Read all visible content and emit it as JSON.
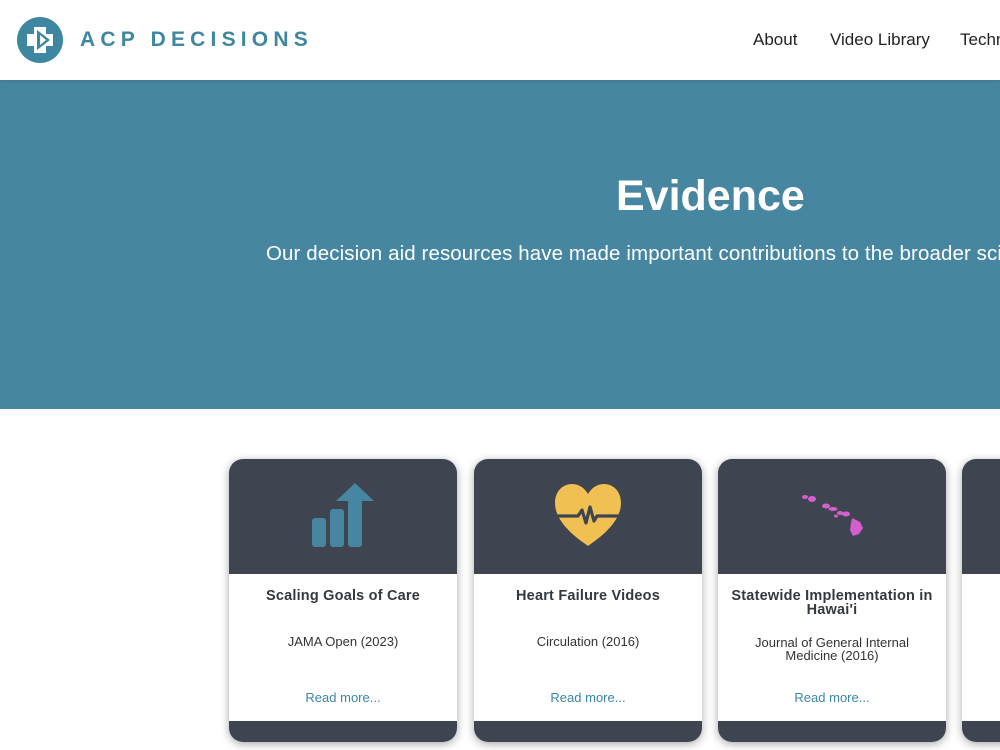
{
  "header": {
    "brand": "ACP DECISIONS",
    "nav": [
      "About",
      "Video Library",
      "Techn"
    ]
  },
  "hero": {
    "title": "Evidence",
    "text": "Our decision aid resources have made important contributions to the broader scie"
  },
  "cards": [
    {
      "title": "Scaling Goals of Care",
      "source": "JAMA Open (2023)",
      "link": "Read more...",
      "icon": "bar-chart-up-icon"
    },
    {
      "title": "Heart Failure Videos",
      "source": "Circulation (2016)",
      "link": "Read more...",
      "icon": "heart-pulse-icon"
    },
    {
      "title": "Statewide Implementation in Hawai'i",
      "source": "Journal of General Internal Medicine (2016)",
      "link": "Read more...",
      "icon": "hawaii-map-icon"
    },
    {
      "title": "",
      "source": "",
      "link": "",
      "icon": ""
    }
  ],
  "colors": {
    "brand": "#3f86a0",
    "hero_bg": "#4786a1",
    "card_dark": "#3e4450",
    "link": "#3a86a7",
    "chart_icon": "#4786a1",
    "heart_icon": "#f0c052",
    "map_icon": "#d65fd0"
  }
}
